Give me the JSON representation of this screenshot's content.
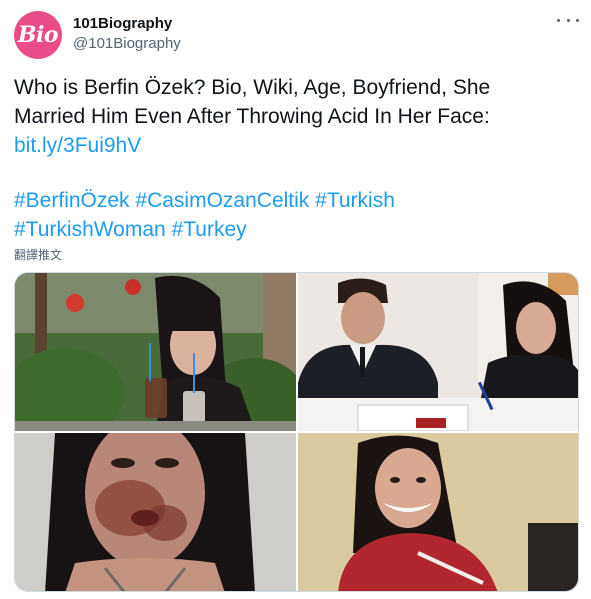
{
  "account": {
    "display_name": "101Biography",
    "handle": "@101Biography",
    "avatar_text": "Bio",
    "avatar_color": "#ea4c89"
  },
  "tweet": {
    "line1": "Who is Berfin Özek? Bio, Wiki, Age, Boyfriend, She",
    "line2": "Married Him Even After Throwing Acid In Her Face:",
    "link": "bit.ly/3Fui9hV",
    "hashtags_line1": [
      "#BerfinÖzek",
      "#CasimOzanCeltik",
      "#Turkish"
    ],
    "hashtags_line2": [
      "#TurkishWoman",
      "#Turkey"
    ]
  },
  "translate_label": "翻譯推文",
  "more_icon": "more-horizontal-icon",
  "colors": {
    "link": "#1d9bf0",
    "text": "#0f1419",
    "secondary": "#536471",
    "border": "#cfd9de"
  }
}
